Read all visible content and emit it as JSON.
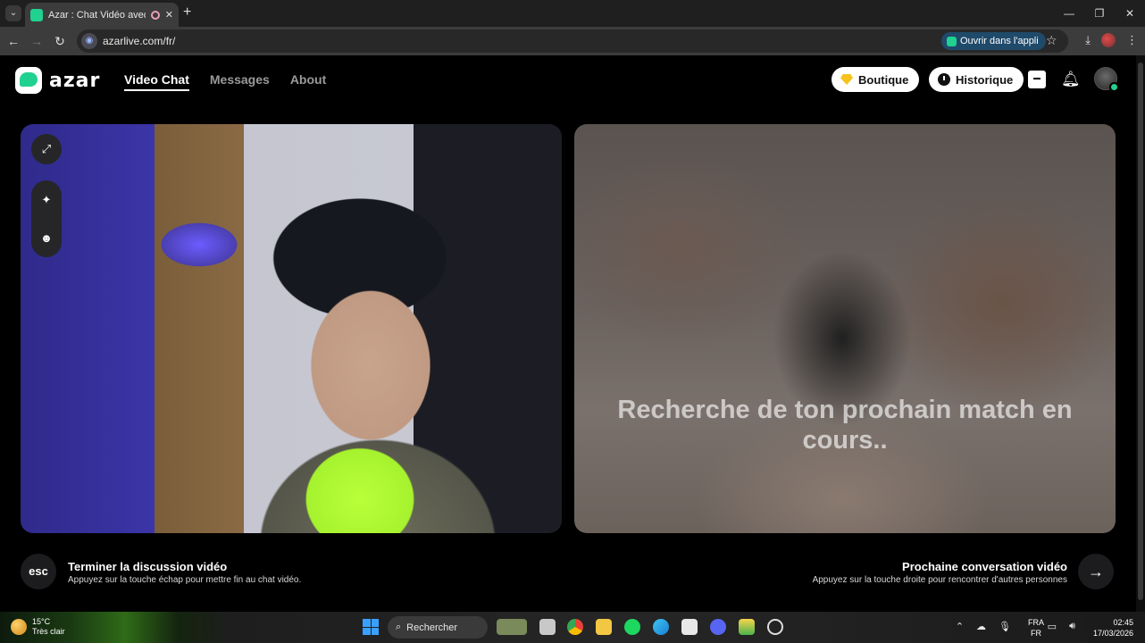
{
  "browser": {
    "tab_title": "Azar : Chat Vidéo avec de n",
    "url": "azarlive.com/fr/",
    "open_in_app": "Ouvrir dans l'appli"
  },
  "site": {
    "logo": "azar",
    "nav": [
      {
        "label": "Video Chat",
        "active": true
      },
      {
        "label": "Messages",
        "active": false
      },
      {
        "label": "About",
        "active": false
      }
    ],
    "boutique": "Boutique",
    "historique": "Historique",
    "brand_color": "#21d18f"
  },
  "right_panel": {
    "status_text": "Recherche de ton prochain match en cours.."
  },
  "controls": {
    "esc_key": "esc",
    "end_title": "Terminer la discussion vidéo",
    "end_hint": "Appuyez sur la touche échap pour mettre fin au chat vidéo.",
    "next_title": "Prochaine conversation vidéo",
    "next_hint": "Appuyez sur la touche droite pour rencontrer d'autres personnes",
    "next_icon": "→"
  },
  "taskbar": {
    "temp": "15°C",
    "weather": "Très clair",
    "search_placeholder": "Rechercher",
    "lang_top": "FRA",
    "lang_bottom": "FR",
    "time": "02:45",
    "date": "17/03/2026"
  }
}
